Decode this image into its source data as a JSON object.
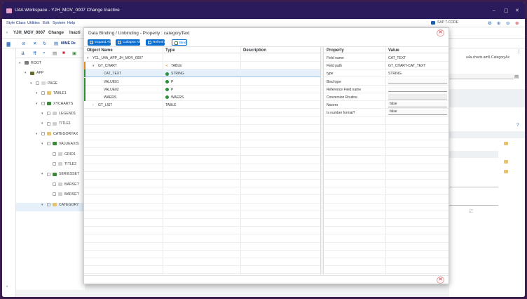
{
  "window": {
    "title": "U4A Workspace - YJH_MOV_0007 Change Inactive"
  },
  "menu": [
    "Style Class",
    "Utilities",
    "Edit",
    "System",
    "Help"
  ],
  "tcode": "SAP T-CODE",
  "docbar": {
    "app": "YJH_MOV_0007",
    "mode": "Change",
    "status": "Inacti"
  },
  "toolbar": {
    "mime": "MIME Re"
  },
  "tree": [
    {
      "label": "ROOT",
      "indent": 0
    },
    {
      "label": "APP",
      "indent": 1
    },
    {
      "label": "PAGE",
      "indent": 2
    },
    {
      "label": "TABLE1",
      "indent": 3
    },
    {
      "label": "XYCHARTS",
      "indent": 3
    },
    {
      "label": "LEGEND1",
      "indent": 4
    },
    {
      "label": "TITLE1",
      "indent": 4
    },
    {
      "label": "CATEGORYAX",
      "indent": 3
    },
    {
      "label": "VALUEAXIS",
      "indent": 4
    },
    {
      "label": "GRID1",
      "indent": 5
    },
    {
      "label": "TITLE2",
      "indent": 5
    },
    {
      "label": "SERIESSET",
      "indent": 4
    },
    {
      "label": "BARSET",
      "indent": 5
    },
    {
      "label": "BARSET",
      "indent": 5
    },
    {
      "label": "CATEGORY",
      "indent": 4
    }
  ],
  "right_pane": {
    "class_name": "u4a.charts.am5.CategoryAx"
  },
  "dialog": {
    "title": "Data Binding / Unbinding - Property : categoryText",
    "buttons": {
      "expand": "Expand All",
      "collapse": "Collapse All",
      "refresh": "Refresh",
      "bind": "Bind"
    },
    "left_headers": {
      "name": "Object Name",
      "type": "Type",
      "desc": "Description"
    },
    "left_rows": [
      {
        "name": "YCL_U4A_APP_JH_MOV_0007",
        "type": "",
        "desc": "",
        "level": 0,
        "icon": "",
        "sel": false,
        "marker": ""
      },
      {
        "name": "GT_CHART",
        "type": "TABLE",
        "desc": "",
        "level": 1,
        "icon": "table",
        "sel": false,
        "marker": "#e08a1a"
      },
      {
        "name": "CAT_TEXT",
        "type": "STRING",
        "desc": "",
        "level": 2,
        "icon": "ok",
        "sel": true,
        "marker": "#2b8f3b"
      },
      {
        "name": "VALUE01",
        "type": "P",
        "desc": "",
        "level": 2,
        "icon": "ok",
        "sel": false,
        "marker": "#2b8f3b"
      },
      {
        "name": "VALUE02",
        "type": "P",
        "desc": "",
        "level": 2,
        "icon": "ok",
        "sel": false,
        "marker": "#2b8f3b"
      },
      {
        "name": "WAERS",
        "type": "WAERS",
        "desc": "",
        "level": 2,
        "icon": "ok",
        "sel": false,
        "marker": "#2b8f3b"
      },
      {
        "name": "GT_LIST",
        "type": "TABLE",
        "desc": "",
        "level": 1,
        "icon": "",
        "sel": false,
        "marker": ""
      }
    ],
    "right_headers": {
      "property": "Property",
      "value": "Value"
    },
    "right_rows": [
      {
        "property": "Field name",
        "value": "CAT_TEXT",
        "kind": "text"
      },
      {
        "property": "Field path",
        "value": "GT_CHART-CAT_TEXT",
        "kind": "text"
      },
      {
        "property": "type",
        "value": "STRING",
        "kind": "text"
      },
      {
        "property": "Bind type",
        "value": "",
        "kind": "input"
      },
      {
        "property": "Reference Field name",
        "value": "",
        "kind": "input"
      },
      {
        "property": "Conversion Routine",
        "value": "",
        "kind": "ro"
      },
      {
        "property": "Nozero",
        "value": "false",
        "kind": "input"
      },
      {
        "property": "Is number format?",
        "value": "false",
        "kind": "input"
      }
    ]
  },
  "colors": {
    "titlebar": "#2b1a5c",
    "accent": "#0a6ed1",
    "frame": "#3a1f4d"
  }
}
